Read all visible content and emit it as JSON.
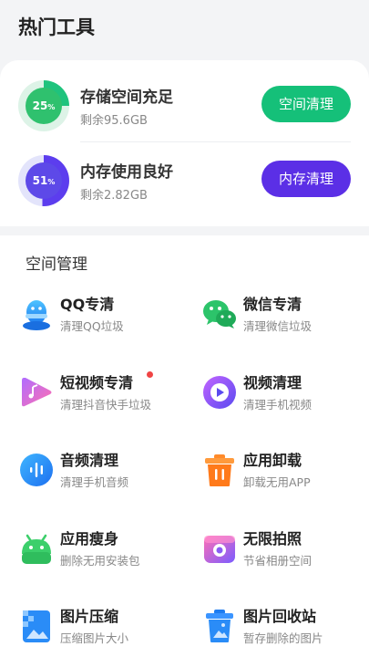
{
  "header": {
    "title": "热门工具"
  },
  "storage": {
    "percent_label": "25",
    "percent_unit": "%",
    "progress": 0.25,
    "title": "存储空间充足",
    "subtitle": "剩余95.6GB",
    "button": "空间清理"
  },
  "memory": {
    "percent_label": "51",
    "percent_unit": "%",
    "progress": 0.51,
    "title": "内存使用良好",
    "subtitle": "剩余2.82GB",
    "button": "内存清理"
  },
  "space_section": {
    "title": "空间管理",
    "tools": [
      {
        "name": "QQ专清",
        "desc": "清理QQ垃圾",
        "icon": "qq-penguin-icon"
      },
      {
        "name": "微信专清",
        "desc": "清理微信垃圾",
        "icon": "wechat-icon"
      },
      {
        "name": "短视频专清",
        "desc": "清理抖音快手垃圾",
        "icon": "short-video-icon",
        "badge": "new-dot"
      },
      {
        "name": "视频清理",
        "desc": "清理手机视频",
        "icon": "video-play-icon"
      },
      {
        "name": "音频清理",
        "desc": "清理手机音频",
        "icon": "audio-icon"
      },
      {
        "name": "应用卸载",
        "desc": "卸载无用APP",
        "icon": "trash-icon"
      },
      {
        "name": "应用瘦身",
        "desc": "删除无用安装包",
        "icon": "android-icon"
      },
      {
        "name": "无限拍照",
        "desc": "节省相册空间",
        "icon": "camera-icon"
      },
      {
        "name": "图片压缩",
        "desc": "压缩图片大小",
        "icon": "image-compress-icon"
      },
      {
        "name": "图片回收站",
        "desc": "暂存删除的图片",
        "icon": "image-recycle-icon"
      }
    ]
  },
  "colors": {
    "green": "#15c079",
    "purple": "#5b2fe6",
    "badge_red": "#f04444"
  }
}
